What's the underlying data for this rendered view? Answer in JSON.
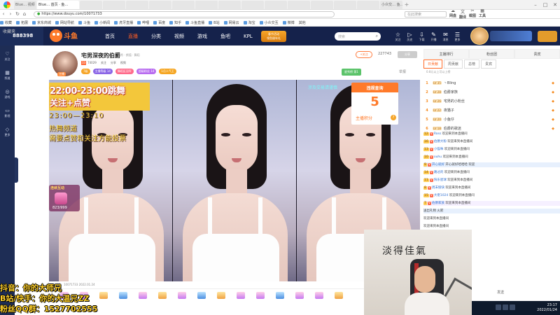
{
  "browser": {
    "tabs": [
      "Blue… 视频",
      "Blue… 首页 · 鱼…",
      "",
      "",
      "",
      "",
      "",
      "",
      "",
      "",
      "",
      "",
      "",
      "",
      "",
      "小众交… 鱼…",
      "",
      ""
    ],
    "url": "https://www.douyu.com/10071733",
    "search_placeholder": "在此搜索",
    "tools": [
      "网盘",
      "翻译",
      "截图",
      "工具"
    ],
    "bookmarks": [
      "收藏",
      "拓展",
      "京东商城",
      "网站导航",
      "斗鱼",
      "小新闻",
      "虎牙直播",
      "哔哩",
      "百度",
      "知乎",
      "斗鱼直播",
      "B站",
      "网易云",
      "淘宝",
      "小众交互",
      "微博",
      "其他"
    ]
  },
  "site": {
    "user_id": "888398",
    "user_tag": "收藏夹",
    "logo_text": "斗鱼",
    "nav": [
      "首页",
      "直播",
      "分类",
      "视频",
      "游戏",
      "鱼吧",
      "KPL"
    ],
    "nav_active": 1,
    "badge_line1": "春节活动",
    "badge_line2": "领鱼翅年礼",
    "search_placeholder": "搜索",
    "header_icons": [
      {
        "icon": "☆",
        "label": "关注"
      },
      {
        "icon": "▷",
        "label": "历史"
      },
      {
        "icon": "⇩",
        "label": "下载"
      },
      {
        "icon": "✎",
        "label": "开播"
      },
      {
        "icon": "✉",
        "label": "消息"
      },
      {
        "icon": "☰",
        "label": "更多"
      }
    ]
  },
  "sidebar": {
    "items": [
      {
        "icon": "♡",
        "label": "关注"
      },
      {
        "icon": "▦",
        "label": "频道"
      },
      {
        "icon": "◎",
        "label": "游戏"
      },
      {
        "icon": "▭",
        "label": "影视"
      },
      {
        "icon": "◇",
        "label": "更多"
      }
    ]
  },
  "anchor": {
    "name": "宅男深夜的伯爵",
    "subtitle": "星秀 · 颜值 · 舞蹈",
    "level": "33",
    "level_tag": "主播",
    "meta": [
      "74029",
      "关注",
      "分享",
      "视频"
    ],
    "badges": [
      {
        "text": "7级",
        "color": "#f6a62a"
      },
      {
        "text": "主播等级 14",
        "color": "#8b66e6"
      },
      {
        "text": "舞蹈区冠军",
        "color": "#ff6a8a"
      },
      {
        "text": "超级粉丝 14",
        "color": "#b86cf0"
      },
      {
        "text": "1月人气王",
        "color": "#f5a623"
      }
    ],
    "follow": "+关注",
    "fans": "227743",
    "share": "分享",
    "rank": "星秀榜 第1",
    "report": "举报"
  },
  "video": {
    "schedule_time": "22:00-23:00跳舞",
    "schedule_text": "关注+点赞",
    "time2": "23:00—23:10",
    "category": "热舞频道",
    "request": "需要点赞和关注方能投票",
    "gift_title": "连续互动",
    "gift_count": "823/999",
    "notification": "涉及交易请谨慎",
    "score_title": "违规查询",
    "score_value": "5",
    "score_label": "主播积分",
    "info": "房间号：10071733  2022.01.24"
  },
  "right_panel": {
    "tabs": [
      "主播排行",
      "粉丝团",
      "贵宾"
    ],
    "subtabs": [
      "日贡献",
      "周贡献",
      "总榜",
      "贵宾"
    ],
    "active_subtab": 0,
    "note": "0.8元以上可以上榜",
    "rank": [
      {
        "num": "1",
        "lv": "LV 35",
        "name": "丶Bling",
        "dot": "◆"
      },
      {
        "num": "2",
        "lv": "LV 28",
        "name": "伯爵家族",
        "dot": "◆"
      },
      {
        "num": "3",
        "lv": "LV 26",
        "name": "宅男的小粉丝",
        "dot": "◆"
      },
      {
        "num": "4",
        "lv": "LV 22",
        "name": "夜猫子",
        "dot": "◆"
      },
      {
        "num": "5",
        "lv": "LV 20",
        "name": "小鱼仔",
        "dot": "◆"
      },
      {
        "num": "6",
        "lv": "LV 18",
        "name": "伯爵的歌迷",
        "dot": "◆"
      }
    ],
    "chat": [
      {
        "lv": "12",
        "name": "Ross",
        "msg": "欢迎来到本直播间",
        "style": ""
      },
      {
        "lv": "16",
        "name": "伯爵大粉",
        "msg": "欢迎来到本直播间",
        "style": ""
      },
      {
        "lv": "13",
        "name": "小猫咪",
        "msg": "欢迎来到本直播间",
        "style": ""
      },
      {
        "lv": "10",
        "name": "ouhu",
        "msg": "欢迎来到本直播间",
        "style": ""
      },
      {
        "lv": "9",
        "name": "开心就好",
        "msg": "开心就好哈哈哈 欢迎",
        "style": "hl"
      },
      {
        "lv": "14",
        "name": "路过的",
        "msg": "欢迎来到本直播间",
        "style": ""
      },
      {
        "lv": "11",
        "name": "快乐星球",
        "msg": "欢迎来到本直播间",
        "style": ""
      },
      {
        "lv": "8",
        "name": "周末愉快",
        "msg": "欢迎来到本直播间",
        "style": ""
      },
      {
        "lv": "15",
        "name": "大佬1024",
        "msg": "欢迎来到本直播间",
        "style": ""
      },
      {
        "lv": "7",
        "name": "伯爵家族",
        "msg": "欢迎来到本直播间",
        "style": "gift"
      },
      {
        "lv": "",
        "name": "",
        "msg": "送出礼物 火箭",
        "style": "hl"
      },
      {
        "lv": "",
        "name": "",
        "msg": "欢迎来到本直播间",
        "style": ""
      },
      {
        "lv": "",
        "name": "",
        "msg": "欢迎来到本直播间",
        "style": ""
      },
      {
        "lv": "",
        "name": "",
        "msg": "欢迎来到本直播间",
        "style": ""
      }
    ],
    "bottom": "发送"
  },
  "webcam": {
    "calligraphy": "淡得佳氣"
  },
  "caption": {
    "line1": "抖音：你的大师兄",
    "line2": "B站/快手：你的大温兄ZZ",
    "line3": "粉丝QQ群：1527702555"
  },
  "clock": {
    "time": "23:17",
    "date": "2022/01/24"
  },
  "colors": {
    "brand_orange": "#ff5d23",
    "header_bg": "#15224b",
    "schedule_bg": "#f3c73b"
  }
}
